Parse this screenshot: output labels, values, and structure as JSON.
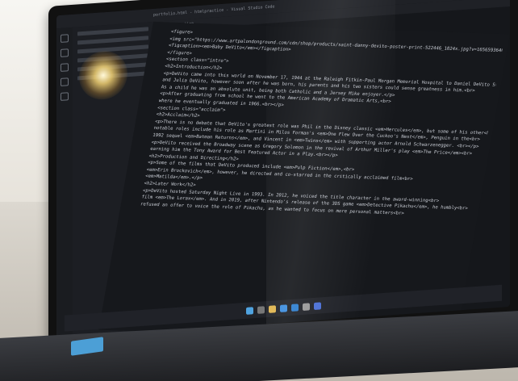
{
  "window": {
    "title": "portfolio.html - htmlpractice - Visual Studio Code",
    "tab_label": "figcaption"
  },
  "code_lines": [
    {
      "text": "<figure>"
    },
    {
      "text": "<img src=\"https://www.artpalondonground.com/cdn/shop/products/saint-danny-devito-poster-print-522446_1024x.jpg?v=1656593646\"/>"
    },
    {
      "text": "<figcaption><em>Baby DeVito</em></figcaption>"
    },
    {
      "text": "</figure>"
    },
    {
      "text": "<section class=\"intro\">"
    },
    {
      "text": "<h2>Introduction</h2>"
    },
    {
      "text": "<p>DeVito came into this world on November 17, 1944 at the Raleigh Fitkin-Paul Morgan Memorial Hospital to Daniel DeVito Sr.<br>"
    },
    {
      "text": "and Julia DeVito, however soon after he was born, his parents and his two sisters could sense greatness in him.<br>"
    },
    {
      "text": "As a child he was an absolute unit, being both Catholic and a Jersey Mike enjoyer.</p>"
    },
    {
      "text": "<p>After graduating from school he went to the American Academy of Dramatic Arts,<br>"
    },
    {
      "text": "where he eventually graduated in 1966.<br></p>"
    },
    {
      "text": "<section class=\"acclaim\">"
    },
    {
      "text": "<h2>Acclaim</h2>"
    },
    {
      "text": "<p>There is no debate that DeVito's greatest role was Phil in the Disney classic <em>Hercules</em>, but some of his other<br>"
    },
    {
      "text": "notable roles include his role as Martini in Milos Forman's <em>One Flew Over the Cuckoo's Nest</em>, Penguin in the<br>"
    },
    {
      "text": "1992 sequel <em>Batman Returns</em>, and Vincent in <em>Twins</em> with supporting actor Arnold Schwarzenegger. <br></p>"
    },
    {
      "text": "<p>DeVito received the Broadway scene as Gregory Solomon in the revival of Arthur Miller's play <em>The Price</em><br>"
    },
    {
      "text": "earning him the Tony Award for Best Featured Actor in a Play.<br></p>"
    },
    {
      "text": "<h2>Production and Directing</h2>"
    },
    {
      "text": "<p>Some of the films that DeVito produced include <em>Pulp Fiction</em>,<br>"
    },
    {
      "text": "<em>Erin Brockovich</em>, however, he directed and co-starred in the critically acclaimed film<br>"
    },
    {
      "text": "<em>Matilda</em>.</p>"
    },
    {
      "text": "<h2>Later Work</h2>"
    },
    {
      "text": "<p>DeVito hosted Saturday Night Live in 1993. In 2012, he voiced the title character in the award-winning<br>"
    },
    {
      "text": "film <em>The Lorax</em>. And in 2019, after Nintendo's release of the 3DS game <em>Detective Pikachu</em>, he humbly<br>"
    },
    {
      "text": "refused an offer to voice the role of Pikachu, as he wanted to focus on more personal matters<br>"
    }
  ],
  "icons": {
    "window_controls": [
      "minimize-icon",
      "maximize-icon",
      "close-icon"
    ],
    "text_cursor": "I"
  },
  "colors": {
    "editor_bg": "#16181c",
    "tag": "#6aa8e8",
    "string": "#e0a36b",
    "hinge_accent": "#4c9fd6"
  }
}
